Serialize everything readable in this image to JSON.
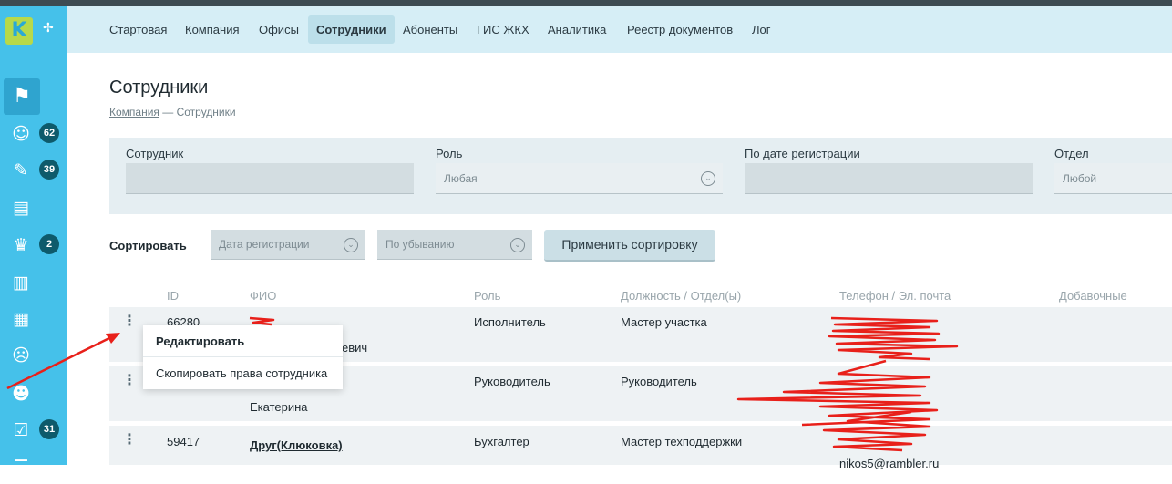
{
  "sidebar": {
    "logo_letter": "K",
    "items": [
      {
        "icon": "flag-icon",
        "glyph": "⚑",
        "badge": ""
      },
      {
        "icon": "users-group-icon",
        "glyph": "☺",
        "badge": "62"
      },
      {
        "icon": "edit-note-icon",
        "glyph": "✎",
        "badge": "39"
      },
      {
        "icon": "documents-icon",
        "glyph": "▤",
        "badge": ""
      },
      {
        "icon": "service-desk-icon",
        "glyph": "♛",
        "badge": "2"
      },
      {
        "icon": "building-icon",
        "glyph": "▥",
        "badge": ""
      },
      {
        "icon": "calculator-icon",
        "glyph": "▦",
        "badge": ""
      },
      {
        "icon": "sad-face-icon",
        "glyph": "☹",
        "badge": ""
      },
      {
        "icon": "team-icon",
        "glyph": "☻",
        "badge": ""
      },
      {
        "icon": "checklist-icon",
        "glyph": "☑",
        "badge": "31"
      },
      {
        "icon": "list-icon",
        "glyph": "☰",
        "badge": ""
      }
    ]
  },
  "nav": {
    "items": [
      "Стартовая",
      "Компания",
      "Офисы",
      "Сотрудники",
      "Абоненты",
      "ГИС ЖКХ",
      "Аналитика",
      "Реестр документов",
      "Лог"
    ],
    "active": "Сотрудники"
  },
  "page": {
    "title": "Сотрудники",
    "breadcrumb_link": "Компания",
    "breadcrumb_rest": " — Сотрудники"
  },
  "filters": {
    "employee_label": "Сотрудник",
    "employee_value": "",
    "role_label": "Роль",
    "role_value": "Любая",
    "date_label": "По дате регистрации",
    "date_value": "",
    "dept_label": "Отдел",
    "dept_value": "Любой"
  },
  "sort": {
    "label": "Сортировать",
    "field_value": "Дата регистрации",
    "order_value": "По убыванию",
    "apply_label": "Применить сортировку"
  },
  "table": {
    "headers": [
      "ID",
      "ФИО",
      "Роль",
      "Должность / Отдел(ы)",
      "Телефон / Эл. почта",
      "Добавочные"
    ],
    "rows": [
      {
        "id": "66280",
        "name": "",
        "name_line2": "евич",
        "role": "Исполнитель",
        "position": "Мастер участка",
        "contact": ""
      },
      {
        "id": "",
        "name": "",
        "name_line2": "Екатерина",
        "role": "Руководитель",
        "position": "Руководитель",
        "contact": ""
      },
      {
        "id": "59417",
        "name": "Друг(Клюковка)",
        "name_line2": "",
        "role": "Бухгалтер",
        "position": "Мастер техподдержки",
        "contact": "nikos5@rambler.ru"
      }
    ]
  },
  "context_menu": {
    "items": [
      "Редактировать",
      "Скопировать права сотрудника"
    ]
  },
  "colors": {
    "sidebar": "#45c1ea",
    "nav_bg": "#d6eef6",
    "logo": "#b7d94a",
    "badge": "#0e5a6b",
    "annotation": "#e8201a"
  }
}
